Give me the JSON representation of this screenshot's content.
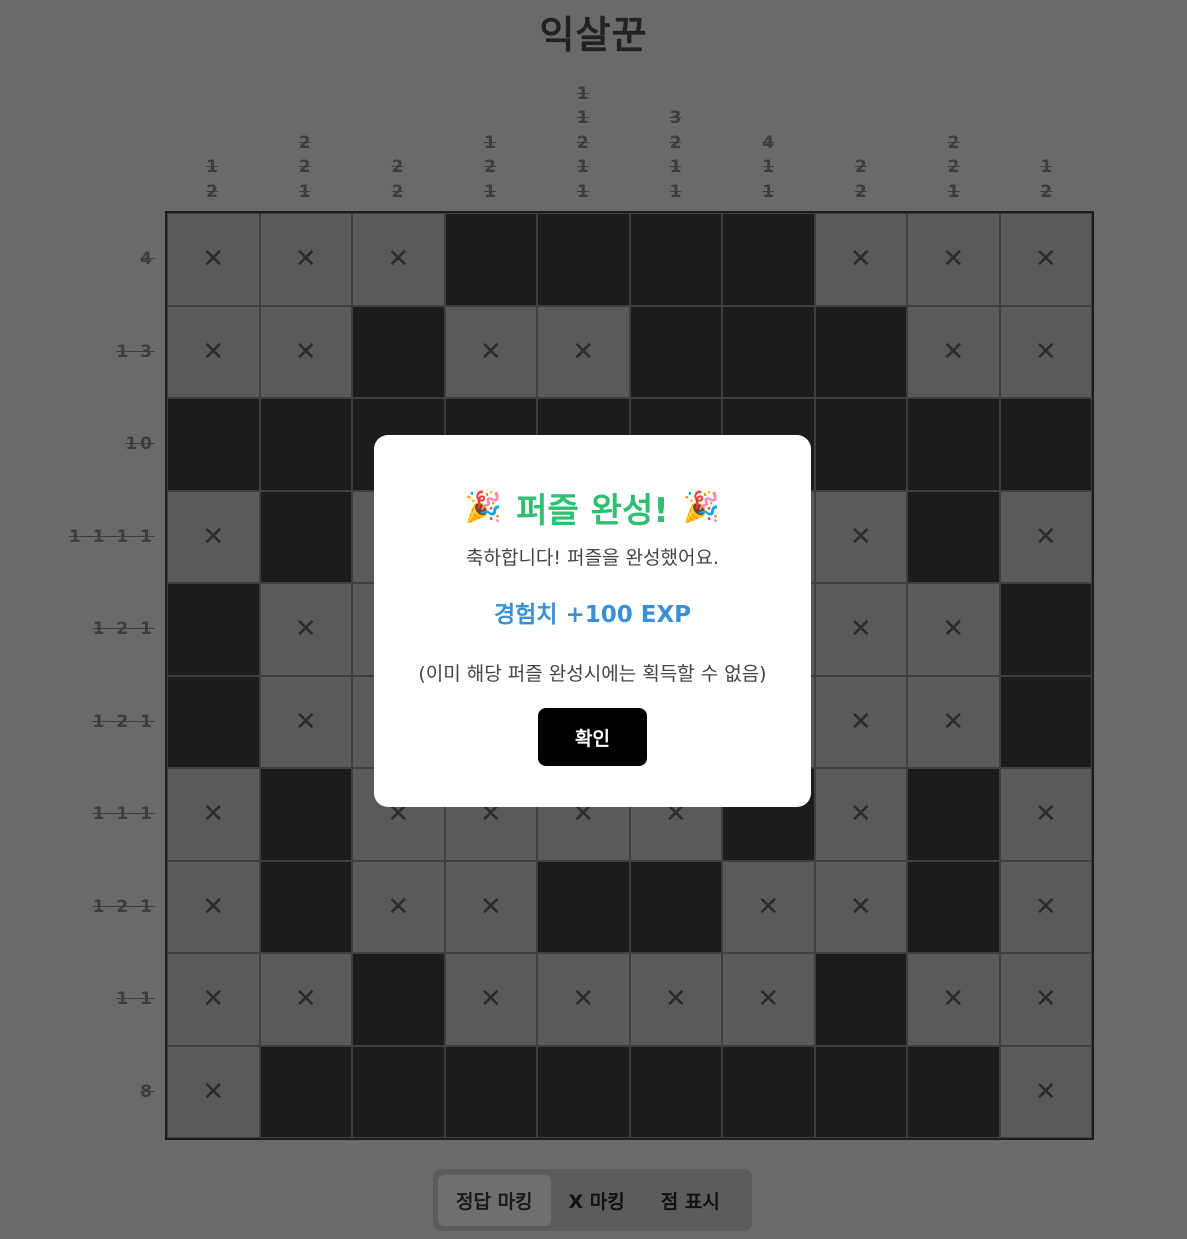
{
  "header": {
    "title": "익살꾼"
  },
  "puzzle": {
    "col_clues": [
      [
        "1",
        "2"
      ],
      [
        "2",
        "2",
        "1"
      ],
      [
        "2",
        "2"
      ],
      [
        "1",
        "2",
        "1"
      ],
      [
        "1",
        "1",
        "2",
        "1",
        "1"
      ],
      [
        "3",
        "2",
        "1",
        "1"
      ],
      [
        "4",
        "1",
        "1"
      ],
      [
        "2",
        "2"
      ],
      [
        "2",
        "2",
        "1"
      ],
      [
        "1",
        "2"
      ]
    ],
    "row_clues": [
      "4",
      "1 3",
      "10",
      "1 1 1 1",
      "1 2 1",
      "1 2 1",
      "1 1 1",
      "1 2 1",
      "1 1",
      "8"
    ],
    "x_mark": "✕",
    "grid": [
      "xxxffffxxx",
      "xxfxxfffxx",
      "ffffffffff",
      "xfxxxxxxfx",
      "fxxxxxxxxf",
      "fxxxxxxxxf",
      "xfxxxxfxfx",
      "xfxxffxxfx",
      "xxfxxxxfxx",
      "xffffffffx"
    ]
  },
  "modes": [
    {
      "label": "정답 마킹",
      "active": true
    },
    {
      "label": "X 마킹",
      "active": false
    },
    {
      "label": "점 표시",
      "active": false
    }
  ],
  "modal": {
    "title": "퍼즐 완성!",
    "party_icon": "🎉",
    "message": "축하합니다! 퍼즐을 완성했어요.",
    "exp": "경험치 +100 EXP",
    "note": "(이미 해당 퍼즐 완성시에는 획득할 수 없음)",
    "confirm_label": "확인"
  },
  "colors": {
    "filled": "#1c1c1c",
    "marked": "#5a5a5a",
    "success": "#2fbf71",
    "exp": "#3b8fd6"
  }
}
